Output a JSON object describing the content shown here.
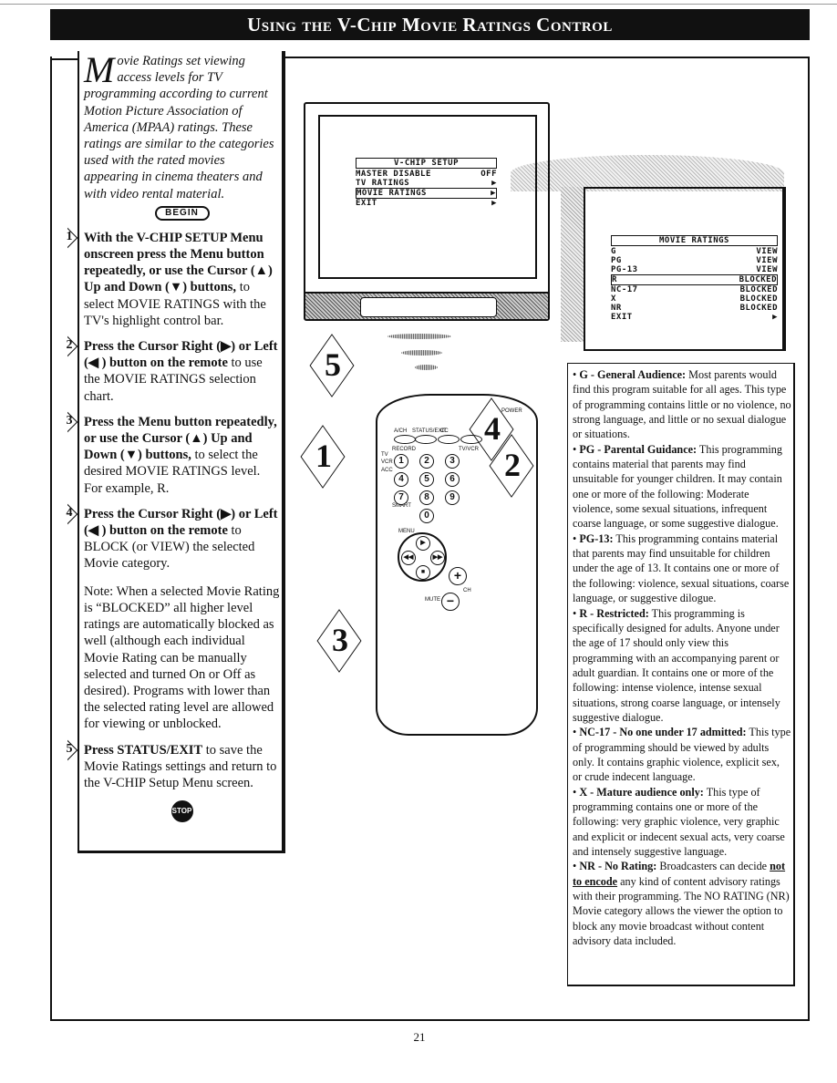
{
  "title": "Using the V-Chip Movie Ratings Control",
  "intro": {
    "dropcap": "M",
    "text": "ovie Ratings set viewing access levels for TV programming according to current Motion Picture Association of America (MPAA) ratings. These ratings are similar to the categories used with the rated movies appearing in cinema theaters and with video rental material."
  },
  "begin_label": "BEGIN",
  "steps": [
    {
      "num": "1",
      "bold": "With the V-CHIP SETUP Menu onscreen press the Menu button repeatedly, or use the Cursor (▲) Up and Down (▼) buttons,",
      "text": " to select MOVIE RATINGS with the TV's highlight control bar."
    },
    {
      "num": "2",
      "bold": "Press the Cursor Right (▶) or Left (◀ ) button on the remote",
      "text": " to use the MOVIE RATINGS selection chart."
    },
    {
      "num": "3",
      "bold": "Press the Menu button repeatedly, or use the Cursor (▲) Up and Down (▼) buttons,",
      "text": " to select the desired MOVIE RATINGS level. For example, R."
    },
    {
      "num": "4",
      "bold": "Press the Cursor Right (▶) or Left (◀ ) button on the remote",
      "text": " to BLOCK (or VIEW) the selected Movie category."
    },
    {
      "num": "5",
      "bold": "Press STATUS/EXIT",
      "text": " to save the Movie Ratings settings and return to the V-CHIP Setup Menu screen."
    }
  ],
  "note": "Note: When a selected Movie Rating is “BLOCKED” all higher level ratings are automatically blocked as well (although each individual Movie Rating can be manually selected and turned On or Off as desired). Programs with lower than the selected rating level are allowed for viewing or unblocked.",
  "stop_label": "STOP",
  "vchip_menu": {
    "header": "V-CHIP SETUP",
    "rows": [
      {
        "label": "MASTER DISABLE",
        "value": "OFF"
      },
      {
        "label": "TV RATINGS",
        "value": "▶"
      },
      {
        "label": "MOVIE RATINGS",
        "value": "▶",
        "selected": true
      },
      {
        "label": "EXIT",
        "value": "▶"
      }
    ]
  },
  "movie_menu": {
    "header": "MOVIE RATINGS",
    "rows": [
      {
        "label": "G",
        "value": "VIEW"
      },
      {
        "label": "PG",
        "value": "VIEW"
      },
      {
        "label": "PG-13",
        "value": "VIEW"
      },
      {
        "label": "R",
        "value": "BLOCKED",
        "selected": true
      },
      {
        "label": "NC-17",
        "value": "BLOCKED"
      },
      {
        "label": "X",
        "value": "BLOCKED"
      },
      {
        "label": "NR",
        "value": "BLOCKED"
      },
      {
        "label": "EXIT",
        "value": "▶"
      }
    ]
  },
  "remote": {
    "labels": {
      "power": "POWER",
      "ach": "A/CH",
      "status": "STATUS/EXIT",
      "cc": "CC",
      "record": "RECORD",
      "tvvcr": "TV/VCR",
      "tv": "TV",
      "vcr": "VCR",
      "acc": "ACC",
      "smart": "SMART",
      "menu": "MENU",
      "mute": "MUTE",
      "ch": "CH"
    },
    "digits": [
      "1",
      "2",
      "3",
      "4",
      "5",
      "6",
      "7",
      "8",
      "9",
      "0"
    ],
    "callouts": [
      "5",
      "4",
      "1",
      "2",
      "3"
    ]
  },
  "ratings": [
    {
      "bold": "G - General Audience:",
      "text": " Most parents would find this program suitable for all ages. This type of programming contains little or no violence, no strong language, and little or no sexual dialogue or situations."
    },
    {
      "bold": "PG - Parental Guidance:",
      "text": " This programming contains material that parents may find unsuitable for younger children. It may contain one or more of the following: Moderate violence, some sexual situations, infrequent coarse language, or some suggestive dialogue."
    },
    {
      "bold": "PG-13:",
      "text": " This programming contains material that parents may find unsuitable for children under the age of 13. It contains one or more of the following: violence, sexual situations, coarse language, or suggestive dilogue."
    },
    {
      "bold": "R - Restricted:",
      "text": " This programming is specifically designed for adults. Anyone under the age of 17 should only view this programming with an accompanying parent or adult guardian. It contains one or more of the following: intense violence, intense sexual situations, strong coarse language, or intensely suggestive dialogue."
    },
    {
      "bold": "NC-17 - No one under 17 admitted:",
      "text": " This type of programming should be viewed by adults only. It contains graphic violence, explicit sex, or crude indecent language."
    },
    {
      "bold": "X - Mature audience only:",
      "text": " This type of programming contains one or more of the following: very graphic violence, very graphic and explicit or indecent sexual acts, very coarse and intensely suggestive language."
    },
    {
      "bold": "NR - No Rating:",
      "text_pre": " Broadcasters can decide ",
      "underline": "not to encode",
      "text": " any kind of content advisory ratings with their programming. The NO RATING (NR) Movie category allows the viewer the option to block any movie broadcast without content advisory data included."
    }
  ],
  "page_number": "21"
}
